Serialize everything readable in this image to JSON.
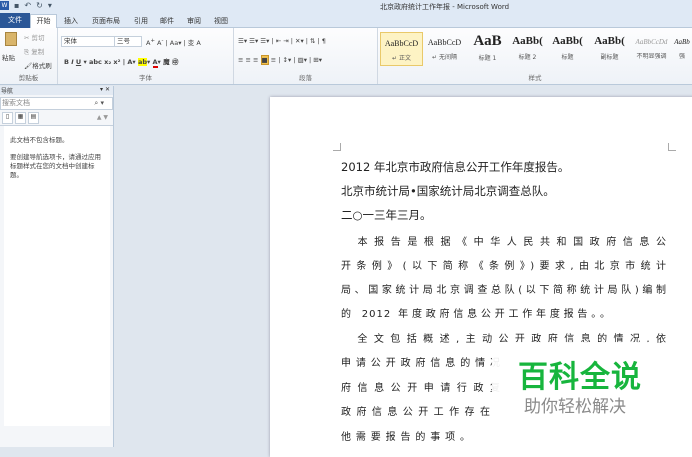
{
  "window": {
    "title": "北京政府统计工作年报 - Microsoft Word"
  },
  "tabs": [
    "文件",
    "开始",
    "插入",
    "页面布局",
    "引用",
    "邮件",
    "审阅",
    "视图"
  ],
  "clipboard": {
    "paste": "粘贴",
    "cut": "剪切",
    "copy": "复制",
    "format_painter": "格式刷",
    "label": "剪贴板"
  },
  "font": {
    "name": "宋体",
    "size": "三号",
    "label": "字体"
  },
  "paragraph": {
    "label": "段落"
  },
  "styles": {
    "label": "样式",
    "items": [
      {
        "preview": "AaBbCcD",
        "name": "↵ 正文"
      },
      {
        "preview": "AaBbCcD",
        "name": "↵ 无间隔"
      },
      {
        "preview": "AaB",
        "name": "标题 1"
      },
      {
        "preview": "AaBb(",
        "name": "标题 2"
      },
      {
        "preview": "AaBb(",
        "name": "标题"
      },
      {
        "preview": "AaBb(",
        "name": "副标题"
      },
      {
        "preview": "AaBbCcDd",
        "name": "不明显强调"
      },
      {
        "preview": "AaBb",
        "name": "强"
      }
    ]
  },
  "nav": {
    "title": "导航",
    "search_placeholder": "搜索文档",
    "msg1": "此文档不包含标题。",
    "msg2": "要创建导航选项卡，请通过应用标题样式在您的文档中创建标题。"
  },
  "document": {
    "lines": [
      "2012 年北京市政府信息公开工作年度报告。",
      "北京市统计局•国家统计局北京调查总队。",
      "二○一三年三月。"
    ],
    "para1": [
      "　本报告是根据《中华人民共和国政府信息公",
      "开条例》(以下简称《条例》)要求,由北京市统计",
      "局、国家统计局北京调查总队(以下简称统计局队)编制",
      "的 2012 年度政府信息公开工作年度报告。。"
    ],
    "para2": [
      "　全文包括概述,主动公开政府信息的情况,依",
      "申请公开政府信息的情况",
      "府信息公开申请行政复",
      "政府信息公开工作存在",
      "他需要报告的事项。"
    ]
  },
  "watermark": {
    "main": "百科全说",
    "sub": "助你轻松解决"
  }
}
